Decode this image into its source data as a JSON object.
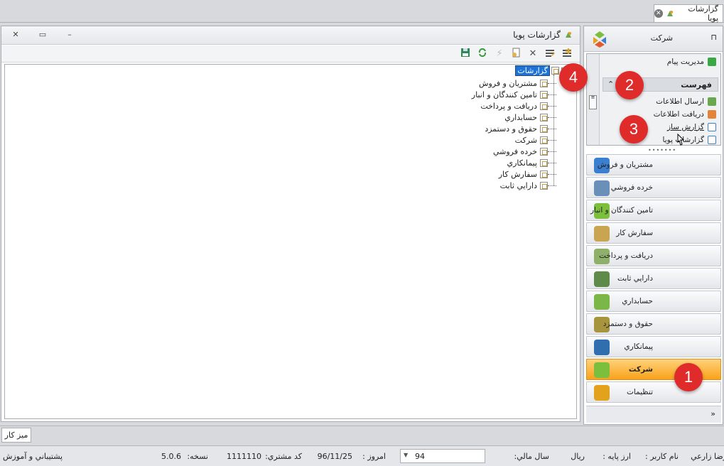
{
  "tab": {
    "title": "گزارشات پويا",
    "close_glyph": "✕"
  },
  "doc_window": {
    "title": "گزارشات پويا",
    "controls": {
      "minimize": "–",
      "maximize": "▭",
      "close": "✕"
    },
    "toolbar": [
      "save-icon",
      "refresh-icon",
      "run-icon",
      "new-document-icon",
      "delete-icon",
      "edit-icon",
      "add-icon"
    ],
    "tree": {
      "root": "گزارشات",
      "children": [
        "مشتريان و فروش",
        "تامين كنندگان و انبار",
        "دريافت و پرداخت",
        "حسابداري",
        "حقوق و دستمزد",
        "شركت",
        "خرده فروشي",
        "پيمانكاري",
        "سفارش كار",
        "دارايي ثابت"
      ]
    }
  },
  "nav_panel": {
    "header_title": "شركت",
    "pin_glyph": "⊓",
    "upper_list": {
      "top_item": "مديريت پيام",
      "group_title": "فهرست",
      "group_chevron": "⌃",
      "items": [
        "ارسال اطلاعات",
        "دريافت اطلاعات",
        "گزارش ساز",
        "گزارشات پويا"
      ]
    },
    "splitter_glyph": "•••••••",
    "modules": [
      {
        "label": "مشتريان و فروش",
        "color": "#3b7fd1"
      },
      {
        "label": "خرده فروشي",
        "color": "#6a8fb8"
      },
      {
        "label": "تامين كنندگان و انبار",
        "color": "#7cbf3c"
      },
      {
        "label": "سفارش كار",
        "color": "#c9a552"
      },
      {
        "label": "دريافت و پرداخت",
        "color": "#8fb06a"
      },
      {
        "label": "دارايي ثابت",
        "color": "#5e8a4a"
      },
      {
        "label": "حسابداري",
        "color": "#7ab648"
      },
      {
        "label": "حقوق و دستمزد",
        "color": "#a6953c"
      },
      {
        "label": "پيمانكاري",
        "color": "#2f6fb0"
      },
      {
        "label": "شركت",
        "color": "#7cbf3c",
        "active": true
      },
      {
        "label": "تنظيمات",
        "color": "#e2a21c"
      }
    ],
    "footer_chevron": "»"
  },
  "markers": [
    "1",
    "2",
    "3",
    "4"
  ],
  "taskbar": {
    "desk_button": "ميز كار"
  },
  "status_bar": {
    "user_label": "نام كاربر :",
    "user_name": "رضا زارعي",
    "currency_label": "ارز پايه :",
    "currency": "ريال",
    "fiscal_year_label": "سال مالي:",
    "fiscal_year": "94",
    "today_label": "امروز :",
    "today": "96/11/25",
    "customer_code_label": "كد مشتري:",
    "customer_code": "1111110",
    "version_label": "نسخه:",
    "version": "5.0.6",
    "support_link": "پشتيباني و آموزش"
  },
  "colors": {
    "accent": "#1f73d6",
    "active_module": "#f9a21a",
    "marker": "#e02b2b"
  }
}
